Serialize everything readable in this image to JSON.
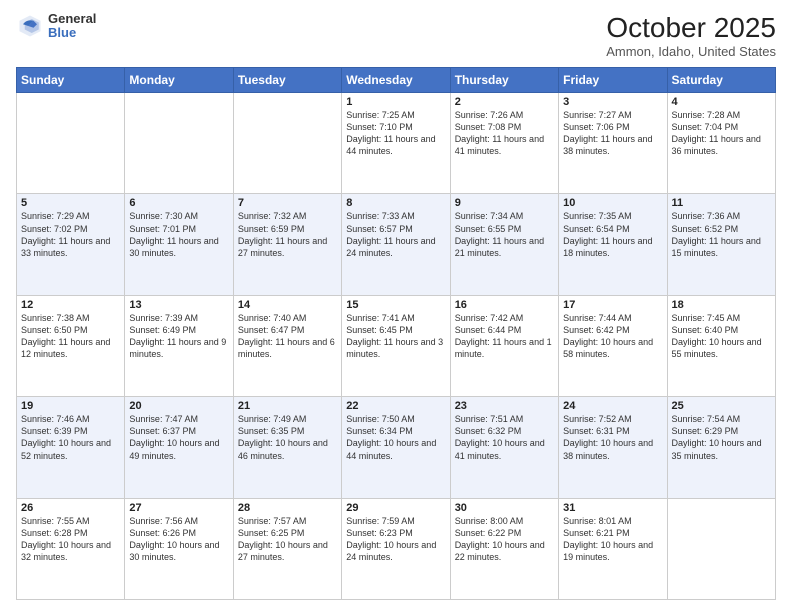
{
  "header": {
    "logo_line1": "General",
    "logo_line2": "Blue",
    "title": "October 2025",
    "subtitle": "Ammon, Idaho, United States"
  },
  "weekdays": [
    "Sunday",
    "Monday",
    "Tuesday",
    "Wednesday",
    "Thursday",
    "Friday",
    "Saturday"
  ],
  "weeks": [
    [
      {
        "day": "",
        "sunrise": "",
        "sunset": "",
        "daylight": ""
      },
      {
        "day": "",
        "sunrise": "",
        "sunset": "",
        "daylight": ""
      },
      {
        "day": "",
        "sunrise": "",
        "sunset": "",
        "daylight": ""
      },
      {
        "day": "1",
        "sunrise": "Sunrise: 7:25 AM",
        "sunset": "Sunset: 7:10 PM",
        "daylight": "Daylight: 11 hours and 44 minutes."
      },
      {
        "day": "2",
        "sunrise": "Sunrise: 7:26 AM",
        "sunset": "Sunset: 7:08 PM",
        "daylight": "Daylight: 11 hours and 41 minutes."
      },
      {
        "day": "3",
        "sunrise": "Sunrise: 7:27 AM",
        "sunset": "Sunset: 7:06 PM",
        "daylight": "Daylight: 11 hours and 38 minutes."
      },
      {
        "day": "4",
        "sunrise": "Sunrise: 7:28 AM",
        "sunset": "Sunset: 7:04 PM",
        "daylight": "Daylight: 11 hours and 36 minutes."
      }
    ],
    [
      {
        "day": "5",
        "sunrise": "Sunrise: 7:29 AM",
        "sunset": "Sunset: 7:02 PM",
        "daylight": "Daylight: 11 hours and 33 minutes."
      },
      {
        "day": "6",
        "sunrise": "Sunrise: 7:30 AM",
        "sunset": "Sunset: 7:01 PM",
        "daylight": "Daylight: 11 hours and 30 minutes."
      },
      {
        "day": "7",
        "sunrise": "Sunrise: 7:32 AM",
        "sunset": "Sunset: 6:59 PM",
        "daylight": "Daylight: 11 hours and 27 minutes."
      },
      {
        "day": "8",
        "sunrise": "Sunrise: 7:33 AM",
        "sunset": "Sunset: 6:57 PM",
        "daylight": "Daylight: 11 hours and 24 minutes."
      },
      {
        "day": "9",
        "sunrise": "Sunrise: 7:34 AM",
        "sunset": "Sunset: 6:55 PM",
        "daylight": "Daylight: 11 hours and 21 minutes."
      },
      {
        "day": "10",
        "sunrise": "Sunrise: 7:35 AM",
        "sunset": "Sunset: 6:54 PM",
        "daylight": "Daylight: 11 hours and 18 minutes."
      },
      {
        "day": "11",
        "sunrise": "Sunrise: 7:36 AM",
        "sunset": "Sunset: 6:52 PM",
        "daylight": "Daylight: 11 hours and 15 minutes."
      }
    ],
    [
      {
        "day": "12",
        "sunrise": "Sunrise: 7:38 AM",
        "sunset": "Sunset: 6:50 PM",
        "daylight": "Daylight: 11 hours and 12 minutes."
      },
      {
        "day": "13",
        "sunrise": "Sunrise: 7:39 AM",
        "sunset": "Sunset: 6:49 PM",
        "daylight": "Daylight: 11 hours and 9 minutes."
      },
      {
        "day": "14",
        "sunrise": "Sunrise: 7:40 AM",
        "sunset": "Sunset: 6:47 PM",
        "daylight": "Daylight: 11 hours and 6 minutes."
      },
      {
        "day": "15",
        "sunrise": "Sunrise: 7:41 AM",
        "sunset": "Sunset: 6:45 PM",
        "daylight": "Daylight: 11 hours and 3 minutes."
      },
      {
        "day": "16",
        "sunrise": "Sunrise: 7:42 AM",
        "sunset": "Sunset: 6:44 PM",
        "daylight": "Daylight: 11 hours and 1 minute."
      },
      {
        "day": "17",
        "sunrise": "Sunrise: 7:44 AM",
        "sunset": "Sunset: 6:42 PM",
        "daylight": "Daylight: 10 hours and 58 minutes."
      },
      {
        "day": "18",
        "sunrise": "Sunrise: 7:45 AM",
        "sunset": "Sunset: 6:40 PM",
        "daylight": "Daylight: 10 hours and 55 minutes."
      }
    ],
    [
      {
        "day": "19",
        "sunrise": "Sunrise: 7:46 AM",
        "sunset": "Sunset: 6:39 PM",
        "daylight": "Daylight: 10 hours and 52 minutes."
      },
      {
        "day": "20",
        "sunrise": "Sunrise: 7:47 AM",
        "sunset": "Sunset: 6:37 PM",
        "daylight": "Daylight: 10 hours and 49 minutes."
      },
      {
        "day": "21",
        "sunrise": "Sunrise: 7:49 AM",
        "sunset": "Sunset: 6:35 PM",
        "daylight": "Daylight: 10 hours and 46 minutes."
      },
      {
        "day": "22",
        "sunrise": "Sunrise: 7:50 AM",
        "sunset": "Sunset: 6:34 PM",
        "daylight": "Daylight: 10 hours and 44 minutes."
      },
      {
        "day": "23",
        "sunrise": "Sunrise: 7:51 AM",
        "sunset": "Sunset: 6:32 PM",
        "daylight": "Daylight: 10 hours and 41 minutes."
      },
      {
        "day": "24",
        "sunrise": "Sunrise: 7:52 AM",
        "sunset": "Sunset: 6:31 PM",
        "daylight": "Daylight: 10 hours and 38 minutes."
      },
      {
        "day": "25",
        "sunrise": "Sunrise: 7:54 AM",
        "sunset": "Sunset: 6:29 PM",
        "daylight": "Daylight: 10 hours and 35 minutes."
      }
    ],
    [
      {
        "day": "26",
        "sunrise": "Sunrise: 7:55 AM",
        "sunset": "Sunset: 6:28 PM",
        "daylight": "Daylight: 10 hours and 32 minutes."
      },
      {
        "day": "27",
        "sunrise": "Sunrise: 7:56 AM",
        "sunset": "Sunset: 6:26 PM",
        "daylight": "Daylight: 10 hours and 30 minutes."
      },
      {
        "day": "28",
        "sunrise": "Sunrise: 7:57 AM",
        "sunset": "Sunset: 6:25 PM",
        "daylight": "Daylight: 10 hours and 27 minutes."
      },
      {
        "day": "29",
        "sunrise": "Sunrise: 7:59 AM",
        "sunset": "Sunset: 6:23 PM",
        "daylight": "Daylight: 10 hours and 24 minutes."
      },
      {
        "day": "30",
        "sunrise": "Sunrise: 8:00 AM",
        "sunset": "Sunset: 6:22 PM",
        "daylight": "Daylight: 10 hours and 22 minutes."
      },
      {
        "day": "31",
        "sunrise": "Sunrise: 8:01 AM",
        "sunset": "Sunset: 6:21 PM",
        "daylight": "Daylight: 10 hours and 19 minutes."
      },
      {
        "day": "",
        "sunrise": "",
        "sunset": "",
        "daylight": ""
      }
    ]
  ]
}
